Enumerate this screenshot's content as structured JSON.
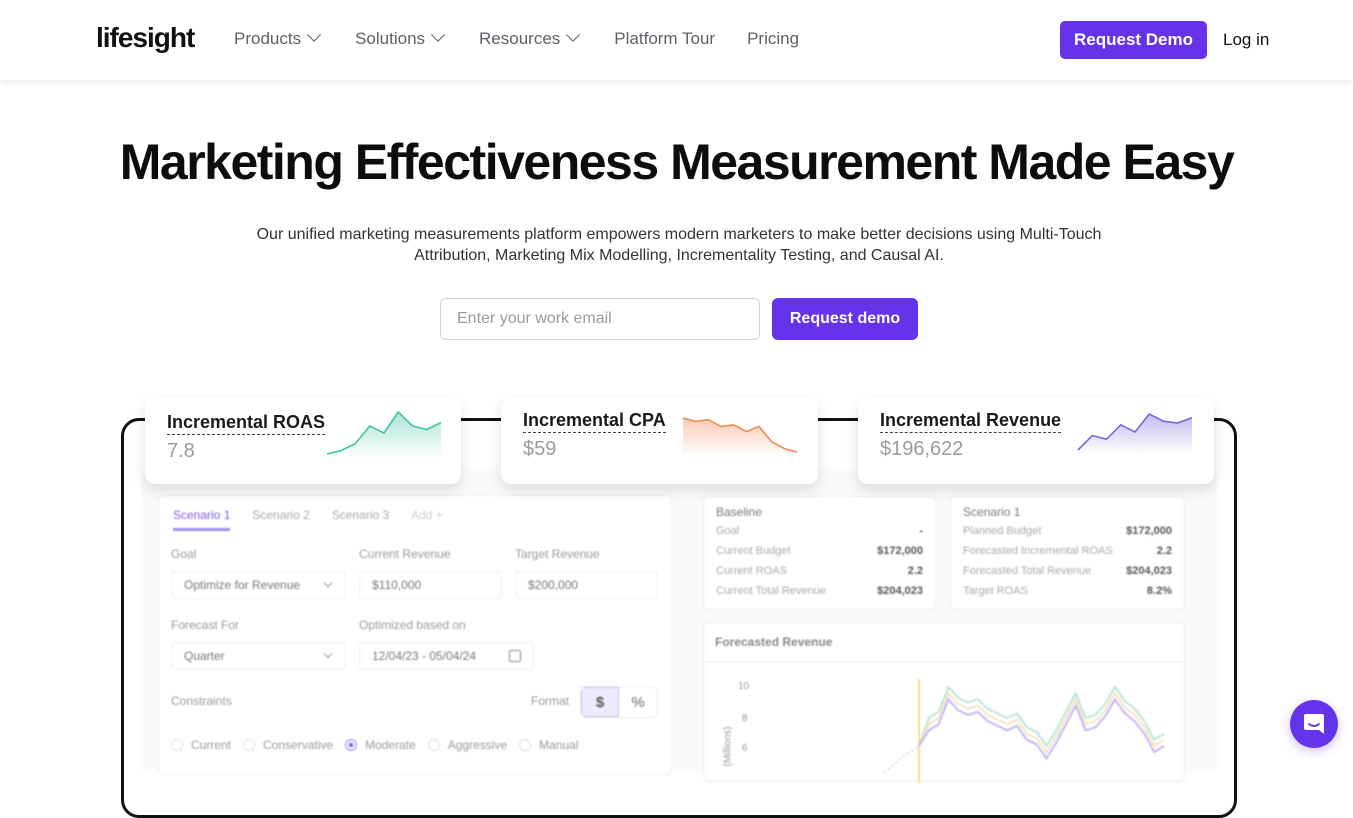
{
  "header": {
    "logo": "lifesight",
    "nav": [
      {
        "label": "Products",
        "has_dropdown": true
      },
      {
        "label": "Solutions",
        "has_dropdown": true
      },
      {
        "label": "Resources",
        "has_dropdown": true
      },
      {
        "label": "Platform Tour",
        "has_dropdown": false
      },
      {
        "label": "Pricing",
        "has_dropdown": false
      }
    ],
    "request_demo": "Request Demo",
    "login": "Log in"
  },
  "hero": {
    "title": "Marketing Effectiveness Measurement Made Easy",
    "subtitle": "Our unified marketing measurements platform empowers modern marketers to make better decisions using Multi-Touch Attribution, Marketing Mix Modelling, Incrementality Testing, and Causal AI.",
    "email_placeholder": "Enter your work email",
    "email_value": "",
    "cta": "Request demo"
  },
  "metrics": [
    {
      "label": "Incremental ROAS",
      "value": "7.8",
      "color": "#3cc6a0",
      "trend": [
        2,
        3,
        5,
        10,
        8,
        14,
        10,
        9,
        11
      ]
    },
    {
      "label": "Incremental CPA",
      "value": "$59",
      "color": "#ee8a55",
      "trend": [
        14,
        13,
        13.5,
        11.5,
        12,
        10,
        11.5,
        7,
        5,
        4
      ]
    },
    {
      "label": "Incremental Revenue",
      "value": "$196,622",
      "color": "#7d66d8",
      "trend": [
        2,
        6,
        5,
        9,
        7,
        12,
        10,
        9.5,
        11
      ]
    }
  ],
  "dashboard": {
    "tabs": [
      "Scenario 1",
      "Scenario 2",
      "Scenario 3",
      "Add +"
    ],
    "active_tab": 0,
    "goal_label": "Goal",
    "goal_value": "Optimize for Revenue",
    "current_revenue_label": "Current Revenue",
    "current_revenue_value": "$110,000",
    "target_revenue_label": "Target Revenue",
    "target_revenue_value": "$200,000",
    "forecast_for_label": "Forecast For",
    "forecast_for_value": "Quarter",
    "optimized_label": "Optimized based on",
    "optimized_value": "12/04/23 - 05/04/24",
    "constraints_label": "Constraints",
    "format_label": "Format",
    "format_options": [
      "$",
      "%"
    ],
    "format_selected": "$",
    "constraints": [
      "Current",
      "Conservative",
      "Moderate",
      "Aggressive",
      "Manual"
    ],
    "constraint_selected": "Moderate",
    "baseline": {
      "title": "Baseline",
      "rows": [
        {
          "k": "Goal",
          "v": "-"
        },
        {
          "k": "Current Budget",
          "v": "$172,000"
        },
        {
          "k": "Current ROAS",
          "v": "2.2"
        },
        {
          "k": "Current Total Revenue",
          "v": "$204,023"
        }
      ]
    },
    "scenario": {
      "title": "Scenario 1",
      "rows": [
        {
          "k": "Planned Budget",
          "v": "$172,000"
        },
        {
          "k": "Forecasted Incremental ROAS",
          "v": "2.2"
        },
        {
          "k": "Forecasted Total Revenue",
          "v": "$204,023"
        },
        {
          "k": "Target ROAS",
          "v": "8.2%"
        }
      ]
    },
    "forecast": {
      "title": "Forecasted Revenue",
      "y_label": "(Millions)",
      "y_ticks": [
        "10",
        "8",
        "6"
      ]
    }
  },
  "chat": {
    "icon": "chat-icon"
  }
}
